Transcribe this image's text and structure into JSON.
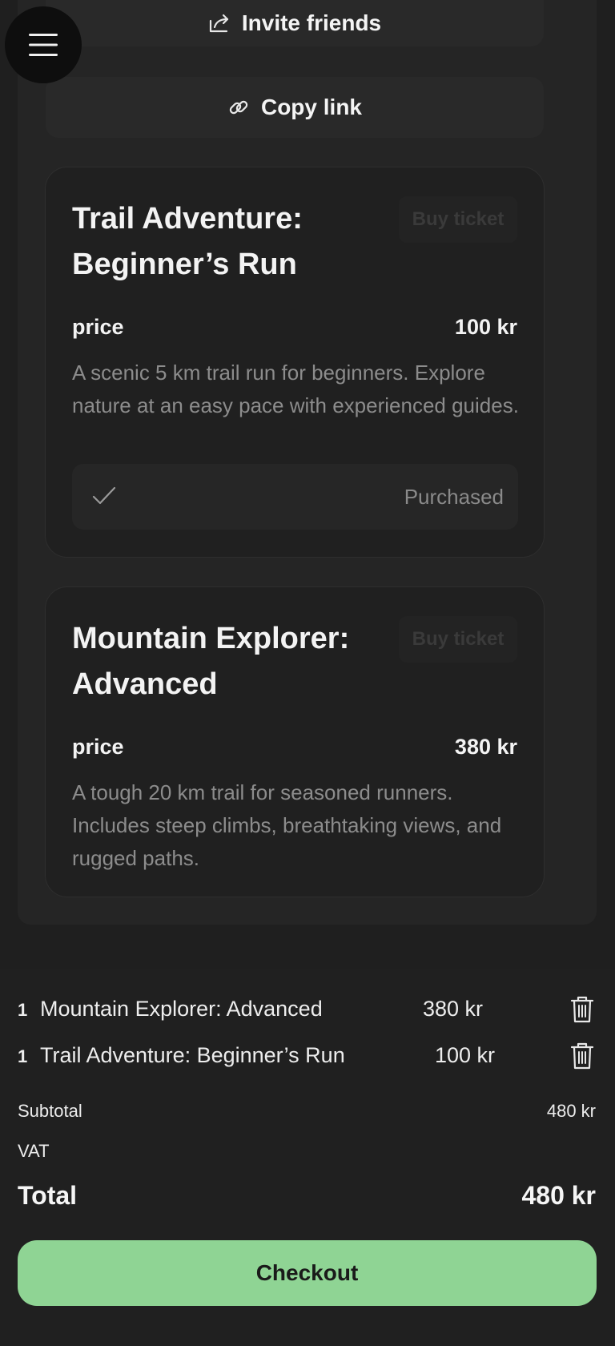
{
  "header": {
    "menu_icon": "hamburger-menu-icon",
    "invite_label": "Invite friends",
    "invite_icon": "share-icon",
    "copy_label": "Copy link",
    "copy_icon": "link-icon"
  },
  "events": [
    {
      "title": "Trail Adventure: Beginner’s Run",
      "buy_label": "Buy ticket",
      "price_label": "price",
      "price": "100 kr",
      "description": "A scenic 5 km trail run for beginners. Explore nature at an easy pace with experienced guides.",
      "status": "Purchased"
    },
    {
      "title": "Mountain Explorer: Advanced",
      "buy_label": "Buy ticket",
      "price_label": "price",
      "price": "380 kr",
      "description": "A tough 20 km trail for seasoned runners. Includes steep climbs, breathtaking views, and rugged paths."
    }
  ],
  "cart": {
    "items": [
      {
        "qty": "1",
        "name": "Mountain Explorer: Advanced",
        "price": "380 kr"
      },
      {
        "qty": "1",
        "name": "Trail Adventure: Beginner’s Run",
        "price": "100 kr"
      }
    ],
    "subtotal_label": "Subtotal",
    "subtotal": "480 kr",
    "vat_label": "VAT",
    "vat": "",
    "total_label": "Total",
    "total": "480 kr",
    "checkout_label": "Checkout"
  },
  "colors": {
    "background": "#1f1f1f",
    "card": "#202020",
    "accent": "#8fd494"
  }
}
